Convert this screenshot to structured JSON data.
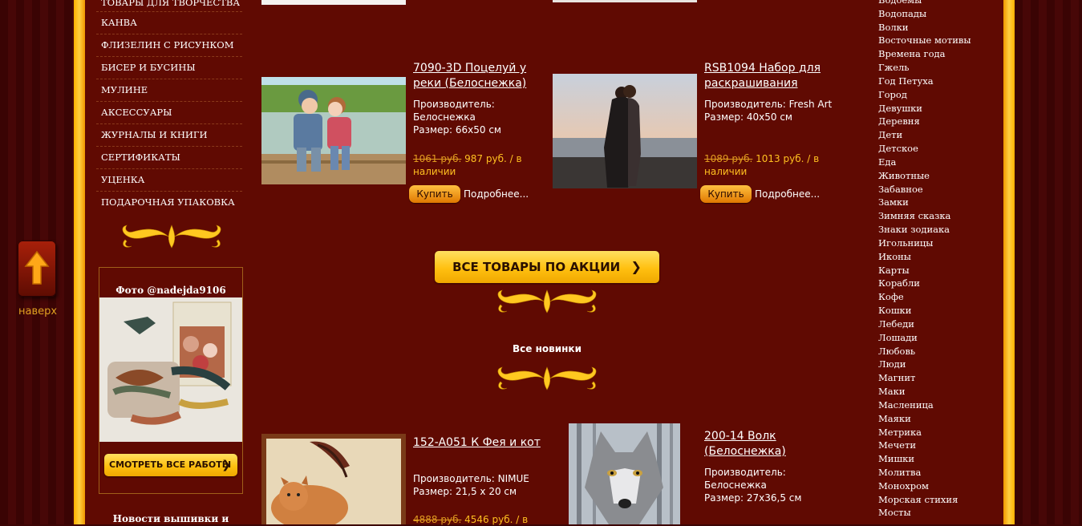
{
  "scroll_top": {
    "label": "наверх"
  },
  "menu": [
    "ТОВАРЫ ДЛЯ ТВОРЧЕСТВА",
    "КАНВА",
    "ФЛИЗЕЛИН С РИСУНКОМ",
    "БИСЕР И БУСИНЫ",
    "МУЛИНЕ",
    "АКСЕССУАРЫ",
    "ЖУРНАЛЫ И КНИГИ",
    "СЕРТИФИКАТЫ",
    "УЦЕНКА",
    "ПОДАРОЧНАЯ УПАКОВКА"
  ],
  "photo": {
    "title": "Фото @nadejda9106",
    "button": "СМОТРЕТЬ ВСЕ РАБОТЫ"
  },
  "news": {
    "title": "Новости вышивки и"
  },
  "products_top": [
    {
      "title": "7090-3D Поцелуй у реки (Белоснежка)",
      "maker": "Производитель: Белоснежка",
      "size": "Размер: 66х50 см",
      "old_price": "1061 руб.",
      "price": "987 руб. / в наличии",
      "buy": "Купить",
      "more": "Подробнее..."
    },
    {
      "title": "RSB1094 Набор для раскрашивания",
      "maker": "Производитель: Fresh Art",
      "size": "Размер: 40х50 см",
      "old_price": "1089 руб.",
      "price": "1013 руб. / в наличии",
      "buy": "Купить",
      "more": "Подробнее..."
    }
  ],
  "sale_button": "ВСЕ ТОВАРЫ ПО АКЦИИ",
  "new_title": "Все новинки",
  "products_new": [
    {
      "title": "152-A051 К Фея и кот",
      "maker": "Производитель: NIMUE",
      "size": "Размер: 21,5 х 20 см",
      "old_price": "4888 руб.",
      "price": "4546 руб. / в"
    },
    {
      "title": "200-14 Волк (Белоснежка)",
      "maker": "Производитель: Белоснежка",
      "size": "Размер: 27х36,5 см",
      "old_price": "",
      "price": ""
    }
  ],
  "categories": [
    "Водоемы",
    "Водопады",
    "Волки",
    "Восточные мотивы",
    "Времена года",
    "Гжель",
    "Год Петуха",
    "Город",
    "Девушки",
    "Деревня",
    "Дети",
    "Детское",
    "Еда",
    "Животные",
    "Забавное",
    "Замки",
    "Зимняя сказка",
    "Знаки зодиака",
    "Игольницы",
    "Иконы",
    "Карты",
    "Корабли",
    "Кофе",
    "Кошки",
    "Лебеди",
    "Лошади",
    "Любовь",
    "Люди",
    "Магнит",
    "Маки",
    "Масленица",
    "Маяки",
    "Метрика",
    "Мечети",
    "Мишки",
    "Молитва",
    "Монохром",
    "Морская стихия",
    "Мосты"
  ],
  "colors": {
    "background": "#600a02",
    "frame": "#ffc020",
    "price": "#ffc020",
    "link": "#ffffff"
  }
}
